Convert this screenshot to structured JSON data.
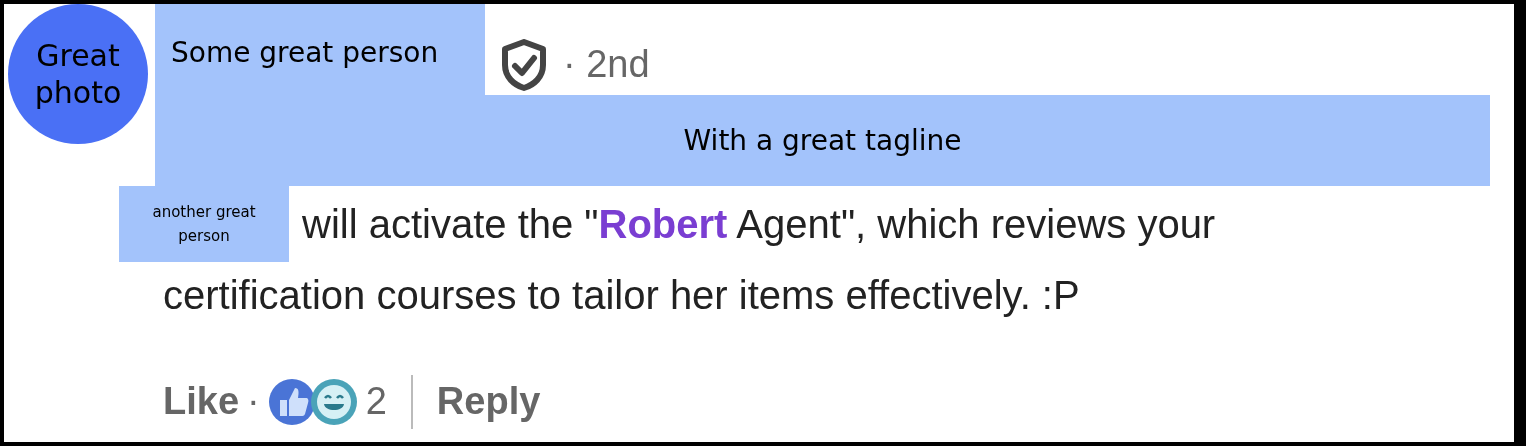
{
  "avatar": {
    "label": "Great photo"
  },
  "author": {
    "name": "Some great person",
    "verified": true,
    "degree": "· 2nd",
    "tagline": "With a great tagline"
  },
  "comment": {
    "mention": "another great person",
    "lines": [
      "will activate the \"**Robert** Agent\", which reviews your",
      "certification courses to tailor her items effectively. :P"
    ]
  },
  "actions": {
    "like": "Like",
    "separator": "·",
    "reactions": [
      {
        "kind": "like"
      },
      {
        "kind": "laugh"
      }
    ],
    "count": "2",
    "reply": "Reply"
  }
}
